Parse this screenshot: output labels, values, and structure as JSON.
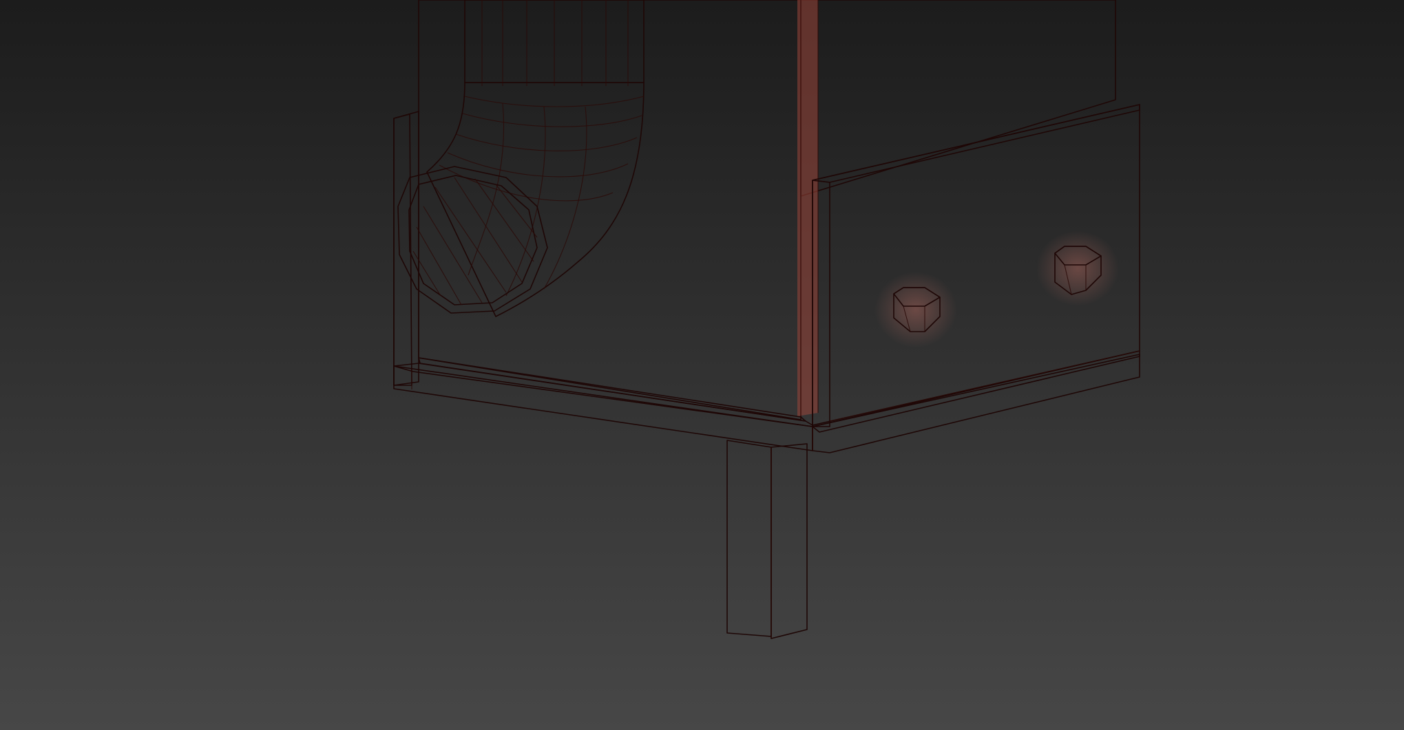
{
  "colors": {
    "background_top": "#1c1c1c",
    "background_bottom": "#474747",
    "model_light": "#8e342c",
    "model_mid": "#7f2820",
    "model_dark": "#6b1f19",
    "model_highlight": "#a24a40",
    "wire": "#1e0706"
  }
}
